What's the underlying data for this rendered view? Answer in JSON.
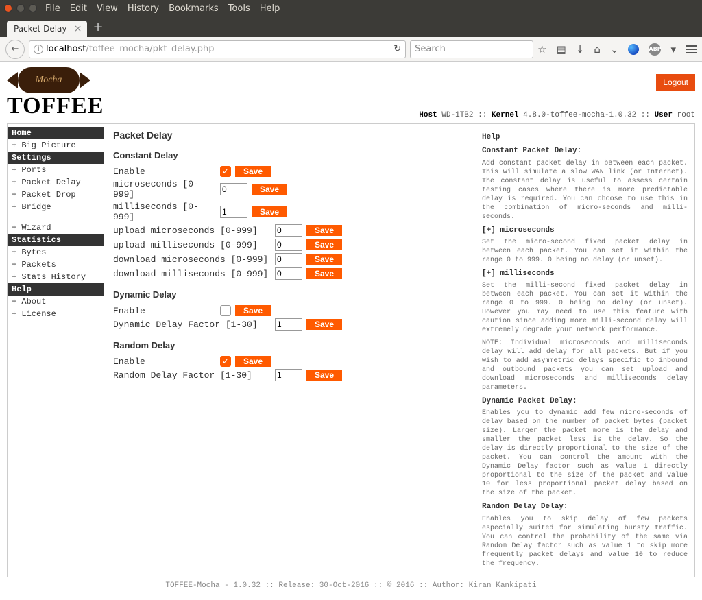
{
  "browser": {
    "menu": [
      "File",
      "Edit",
      "View",
      "History",
      "Bookmarks",
      "Tools",
      "Help"
    ],
    "tab_title": "Packet Delay",
    "url_prefix": "localhost",
    "url_path": "/toffee_mocha/pkt_delay.php",
    "search_placeholder": "Search"
  },
  "logo": {
    "script": "Mocha",
    "name": "TOFFEE"
  },
  "sysinfo": {
    "host_label": "Host",
    "host": "WD-1TB2",
    "kernel_label": "Kernel",
    "kernel": "4.8.0-toffee-mocha-1.0.32",
    "user_label": "User",
    "user": "root"
  },
  "logout": "Logout",
  "sidebar": {
    "home": "Home",
    "big_picture": "+ Big Picture",
    "settings": "Settings",
    "ports": "+ Ports",
    "packet_delay": "+ Packet Delay",
    "packet_drop": "+ Packet Drop",
    "bridge": "+ Bridge",
    "wizard": "+ Wizard",
    "statistics": "Statistics",
    "bytes": "+ Bytes",
    "packets": "+ Packets",
    "stats_history": "+ Stats History",
    "help": "Help",
    "about": "+ About",
    "license": "+ License"
  },
  "page_title": "Packet Delay",
  "constant": {
    "heading": "Constant Delay",
    "enable_label": "Enable",
    "micro_label": "microseconds [0-999]",
    "micro_val": "0",
    "milli_label": "milliseconds [0-999]",
    "milli_val": "1",
    "up_micro_label": "upload microseconds [0-999]",
    "up_micro_val": "0",
    "up_milli_label": "upload milliseconds [0-999]",
    "up_milli_val": "0",
    "dn_micro_label": "download microseconds [0-999]",
    "dn_micro_val": "0",
    "dn_milli_label": "download milliseconds [0-999]",
    "dn_milli_val": "0"
  },
  "dynamic": {
    "heading": "Dynamic Delay",
    "enable_label": "Enable",
    "factor_label": "Dynamic Delay Factor [1-30]",
    "factor_val": "1"
  },
  "random": {
    "heading": "Random Delay",
    "enable_label": "Enable",
    "factor_label": "Random Delay Factor [1-30]",
    "factor_val": "1"
  },
  "save_label": "Save",
  "helppanel": {
    "heading": "Help",
    "h1": "Constant Packet Delay:",
    "p1": "Add constant packet delay in between each packet. This will simulate a slow WAN link (or Internet). The constant delay is useful to assess certain testing cases where there is more predictable delay is required. You can choose to use this in the combination of micro-seconds and milli-seconds.",
    "h2": "[+] microseconds",
    "p2": "Set the micro-second fixed packet delay in between each packet. You can set it within the range 0 to 999. 0 being no delay (or unset).",
    "h3": "[+] milliseconds",
    "p3": "Set the milli-second fixed packet delay in between each packet. You can set it within the range 0 to 999. 0 being no delay (or unset). However you may need to use this feature with caution since adding more milli-second delay will extremely degrade your network performance.",
    "p4": "NOTE: Individual microseconds and milliseconds delay will add delay for all packets. But if you wish to add asymmetric delays specific to inbound and outbound packets you can set upload and download microseconds and milliseconds delay parameters.",
    "h5": "Dynamic Packet Delay:",
    "p5": "Enables you to dynamic add few micro-seconds of delay based on the number of packet bytes (packet size). Larger the packet more is the delay and smaller the packet less is the delay. So the delay is directly proportional to the size of the packet. You can control the amount with the Dynamic Delay factor such as value 1 directly proportional to the size of the packet and value 10 for less proportional packet delay based on the size of the packet.",
    "h6": "Random Delay Delay:",
    "p6": "Enables you to skip delay of few packets especially suited for simulating bursty traffic. You can control the probability of the same via Random Delay factor such as value 1 to skip more frequently packet delays and value 10 to reduce the frequency."
  },
  "footer": "TOFFEE-Mocha - 1.0.32 :: Release: 30-Oct-2016 :: © 2016 :: Author: Kiran Kankipati"
}
